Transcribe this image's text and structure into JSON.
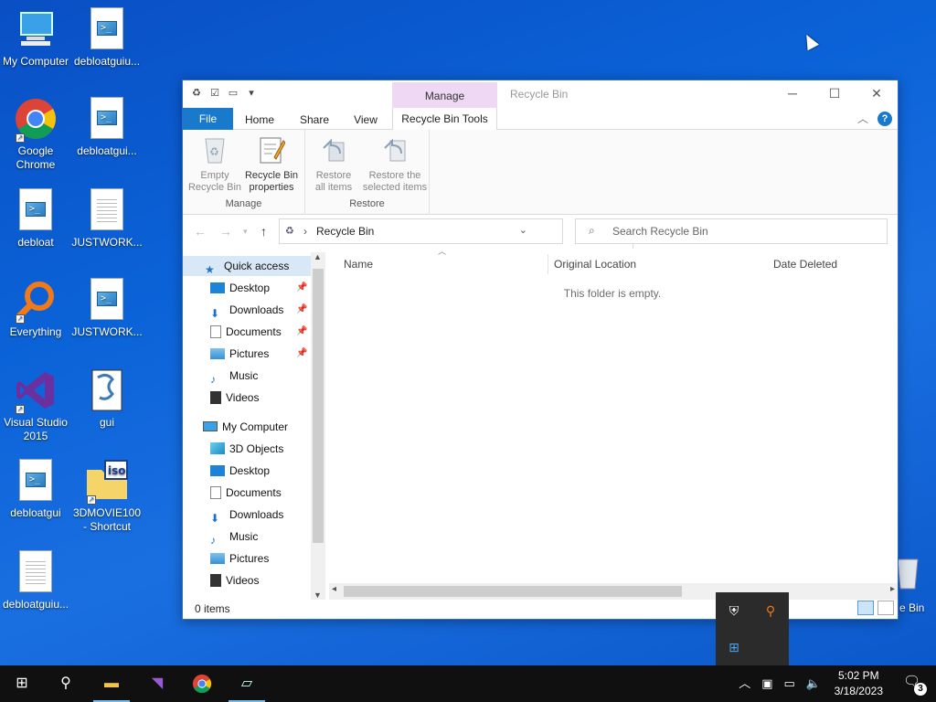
{
  "desktop": {
    "icons": [
      {
        "label": "My Computer"
      },
      {
        "label": "debloatguiu..."
      },
      {
        "label": "Google Chrome"
      },
      {
        "label": "debloatgui..."
      },
      {
        "label": "debloat"
      },
      {
        "label": "JUSTWORK..."
      },
      {
        "label": "Everything"
      },
      {
        "label": "JUSTWORK..."
      },
      {
        "label": "Visual Studio 2015"
      },
      {
        "label": "gui"
      },
      {
        "label": "debloatgui"
      },
      {
        "label": "3DMOVIE100 - Shortcut"
      },
      {
        "label": "debloatguiu..."
      }
    ],
    "partial_icon_label": "e Bin"
  },
  "window": {
    "title": "Recycle Bin",
    "context_tab_header": "Manage",
    "tabs": [
      "File",
      "Home",
      "Share",
      "View",
      "Recycle Bin Tools"
    ],
    "ribbon": {
      "manage": {
        "label": "Manage",
        "buttons": [
          "Empty\nRecycle Bin",
          "Recycle Bin\nproperties"
        ]
      },
      "restore": {
        "label": "Restore",
        "buttons": [
          "Restore\nall items",
          "Restore the\nselected items"
        ]
      }
    },
    "address": {
      "path": "Recycle Bin",
      "search_placeholder": "Search Recycle Bin"
    },
    "nav_pane": {
      "quick_access": "Quick access",
      "quick_items": [
        "Desktop",
        "Downloads",
        "Documents",
        "Pictures",
        "Music",
        "Videos"
      ],
      "my_computer": "My Computer",
      "computer_items": [
        "3D Objects",
        "Desktop",
        "Documents",
        "Downloads",
        "Music",
        "Pictures",
        "Videos"
      ]
    },
    "columns": [
      "Name",
      "Original Location",
      "Date Deleted"
    ],
    "empty_message": "This folder is empty.",
    "status": "0 items"
  },
  "taskbar": {
    "clock_time": "5:02 PM",
    "clock_date": "3/18/2023",
    "notification_count": "3"
  },
  "colors": {
    "accent": "#1979ca",
    "context_tab": "#eed8f3",
    "taskbar": "#101010"
  }
}
